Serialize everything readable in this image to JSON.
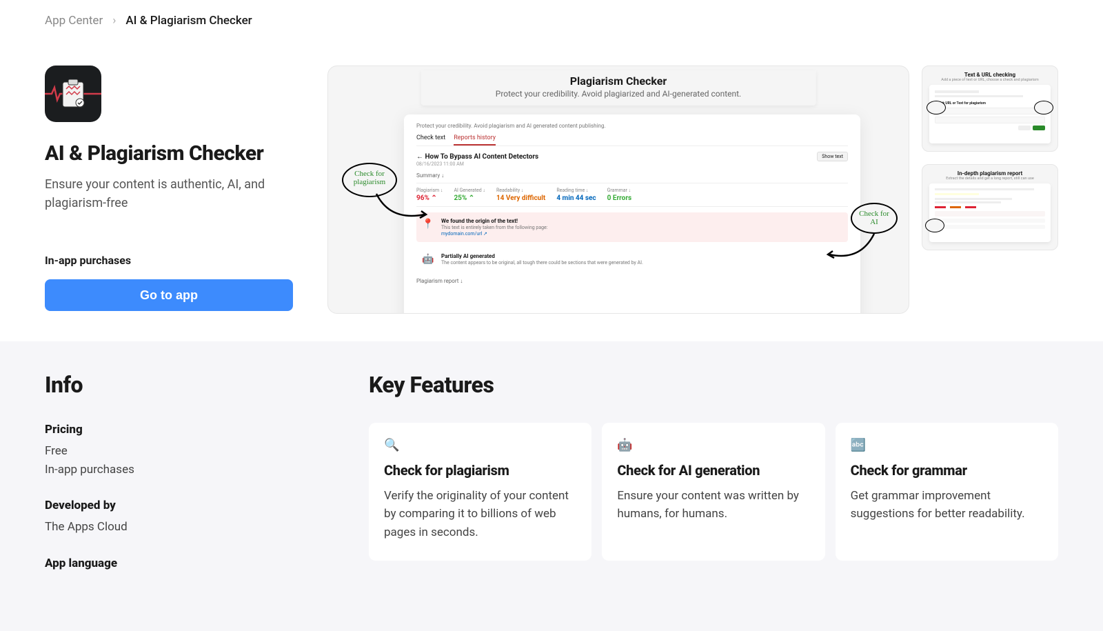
{
  "breadcrumb": {
    "root": "App Center",
    "current": "AI & Plagiarism Checker"
  },
  "app": {
    "title": "AI & Plagiarism Checker",
    "subtitle": "Ensure your content is authentic, AI, and plagiarism-free",
    "purchases_note": "In-app purchases",
    "cta": "Go to app"
  },
  "preview": {
    "title": "Plagiarism Checker",
    "subtitle": "Protect your credibility. Avoid plagiarized and AI-generated content.",
    "report": {
      "desc": "Protect your credibility. Avoid plagiarism and AI generated content publishing.",
      "tabs": {
        "check": "Check text",
        "history": "Reports history"
      },
      "title": "← How To Bypass AI Content Detectors",
      "date": "08/16/2023 11:00 AM",
      "show_text": "Show text",
      "summary_label": "Summary ↓",
      "metrics": {
        "plagiarism": {
          "label": "Plagiarism ↓",
          "value": "96% ⌃"
        },
        "ai": {
          "label": "AI Generated ↓",
          "value": "25% ⌃"
        },
        "readability": {
          "label": "Readability ↓",
          "value": "14 Very difficult"
        },
        "reading": {
          "label": "Reading time ↓",
          "value": "4 min 44 sec"
        },
        "grammar": {
          "label": "Grammar ↓",
          "value": "0 Errors"
        }
      },
      "finding1": {
        "title": "We found the origin of the text!",
        "desc": "This text is entirely taken from the following page:",
        "link": "mydomain.com/url ↗"
      },
      "finding2": {
        "title": "Partially AI generated",
        "desc": "The content appears to be original, all tough there could be sections that were generated by AI."
      },
      "plag_report_label": "Plagiarism report ↓"
    },
    "annotations": {
      "left": "Check for plagiarism",
      "right": "Check for AI"
    }
  },
  "thumbs": {
    "t1": {
      "title": "Text & URL checking",
      "sub": "Add a piece of text or URL, choose a check and plagiarism"
    },
    "t2": {
      "title": "In-depth plagiarism report",
      "sub": "Extract the details and get a long report, still can use"
    }
  },
  "info": {
    "heading": "Info",
    "pricing": {
      "label": "Pricing",
      "line1": "Free",
      "line2": "In-app purchases"
    },
    "developed": {
      "label": "Developed by",
      "value": "The Apps Cloud"
    },
    "language": {
      "label": "App language"
    }
  },
  "features": {
    "heading": "Key Features",
    "items": [
      {
        "icon": "🔍",
        "title": "Check for plagiarism",
        "desc": "Verify the originality of your content by comparing it to billions of web pages in seconds."
      },
      {
        "icon": "🤖",
        "title": "Check for AI generation",
        "desc": "Ensure your content was written by humans, for humans."
      },
      {
        "icon": "🔤",
        "title": "Check for grammar",
        "desc": "Get grammar improvement suggestions for better readability."
      }
    ]
  }
}
